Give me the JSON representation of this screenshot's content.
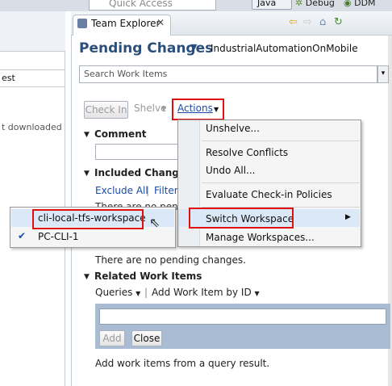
{
  "toolbar": {
    "quick_access_placeholder": "Quick Access",
    "perspectives": [
      "Java",
      "Debug",
      "DDM"
    ]
  },
  "left_panel": {
    "header_fragment": "est",
    "status_fragment": "t downloaded"
  },
  "view": {
    "tab_label": "Team Explorer",
    "tab_close": "✕",
    "nav_icons": [
      "arrow-left-icon",
      "arrow-right-icon",
      "home-icon",
      "refresh-icon"
    ]
  },
  "header": {
    "title": "Pending Changes",
    "project": "IndustrialAutomationOnMobile"
  },
  "search": {
    "placeholder": "Search Work Items"
  },
  "buttons": {
    "check_in": "Check In",
    "shelve": "Shelve",
    "actions": "Actions"
  },
  "sections": {
    "comment": "Comment",
    "included_changes": "Included Changes",
    "exclude_all": "Exclude All",
    "filter": "Filter",
    "no_pending_top": "There are no pendi",
    "no_pending_bottom": "There are no pending changes.",
    "related_work_items": "Related Work Items",
    "queries": "Queries",
    "add_work_item_by_id": "Add Work Item by ID",
    "add": "Add",
    "close": "Close",
    "hint": "Add work items from a query result."
  },
  "actions_menu": {
    "unshelve": "Unshelve...",
    "resolve_conflicts": "Resolve Conflicts",
    "undo_all": "Undo All...",
    "evaluate_checkin_policies": "Evaluate Check-in Policies",
    "switch_workspace": "Switch Workspace",
    "manage_workspaces": "Manage Workspaces..."
  },
  "workspace_submenu": {
    "items": [
      {
        "label": "cli-local-tfs-workspace",
        "checked": false
      },
      {
        "label": "PC-CLI-1",
        "checked": true
      }
    ],
    "check_mark": "✔"
  },
  "colors": {
    "highlight_box": "#e01010",
    "title_blue": "#2b4f7a",
    "link_blue": "#1b4ba7",
    "menu_highlight": "#dbe8f8"
  }
}
